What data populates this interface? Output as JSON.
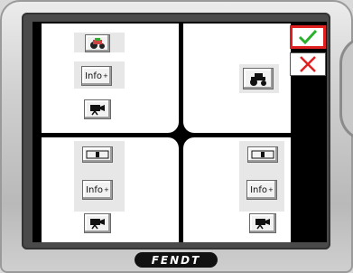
{
  "brand": {
    "name": "FENDT"
  },
  "panes": {
    "top_left": {
      "info_label": "Info",
      "info_sup": "+",
      "icons": [
        "camera-tractor-icon",
        "video-camera-icon"
      ]
    },
    "top_right": {
      "icons": [
        "tractor-icon"
      ]
    },
    "bottom_left": {
      "info_label": "Info",
      "info_sup": "+",
      "icons": [
        "split-bar-icon",
        "video-camera-icon"
      ]
    },
    "bottom_right": {
      "info_label": "Info",
      "info_sup": "+",
      "icons": [
        "split-bar-icon",
        "video-camera-icon"
      ]
    }
  },
  "side_buttons": {
    "confirm_icon": "check-icon",
    "cancel_icon": "cross-icon"
  },
  "colors": {
    "confirm": "#2bb02b",
    "cancel": "#e02020",
    "highlight": "#e02020"
  }
}
